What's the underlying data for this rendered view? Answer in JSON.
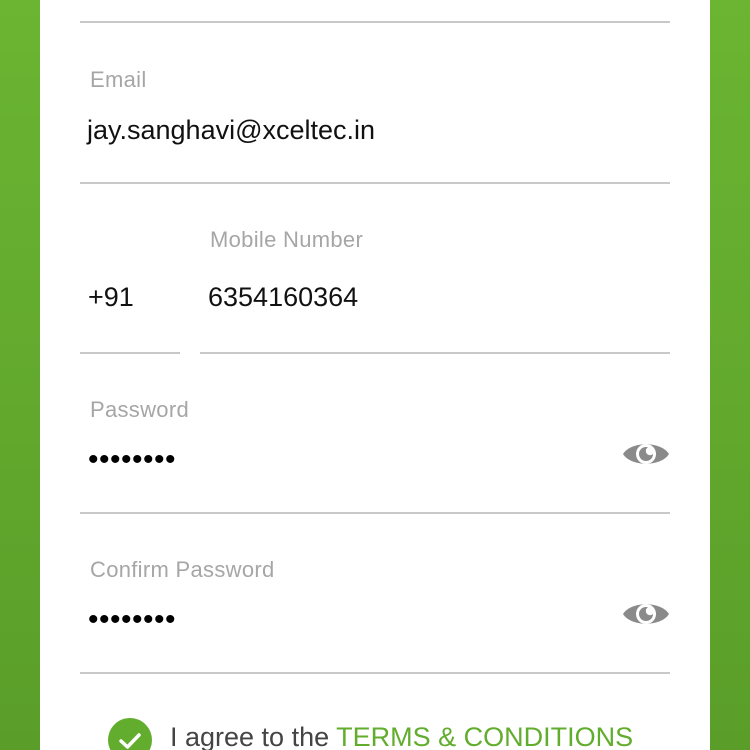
{
  "form": {
    "email": {
      "label": "Email",
      "value": "jay.sanghavi@xceltec.in"
    },
    "mobile": {
      "country_code": "+91",
      "label": "Mobile Number",
      "value": "6354160364"
    },
    "password": {
      "label": "Password",
      "masked_value": "••••••••",
      "toggle_icon": "eye-icon"
    },
    "confirm_password": {
      "label": "Confirm Password",
      "masked_value": "••••••••",
      "toggle_icon": "eye-icon"
    },
    "terms": {
      "prefix": "I agree to the",
      "link_label": "TERMS & CONDITIONS",
      "checked": true,
      "check_icon": "checkmark-icon"
    }
  },
  "colors": {
    "brand_green": "#62ad2e",
    "background_green": "#6bb532",
    "label_gray": "#a6a6a6",
    "divider_gray": "#c8c8c8",
    "eye_icon_gray": "#8a8a8a"
  }
}
